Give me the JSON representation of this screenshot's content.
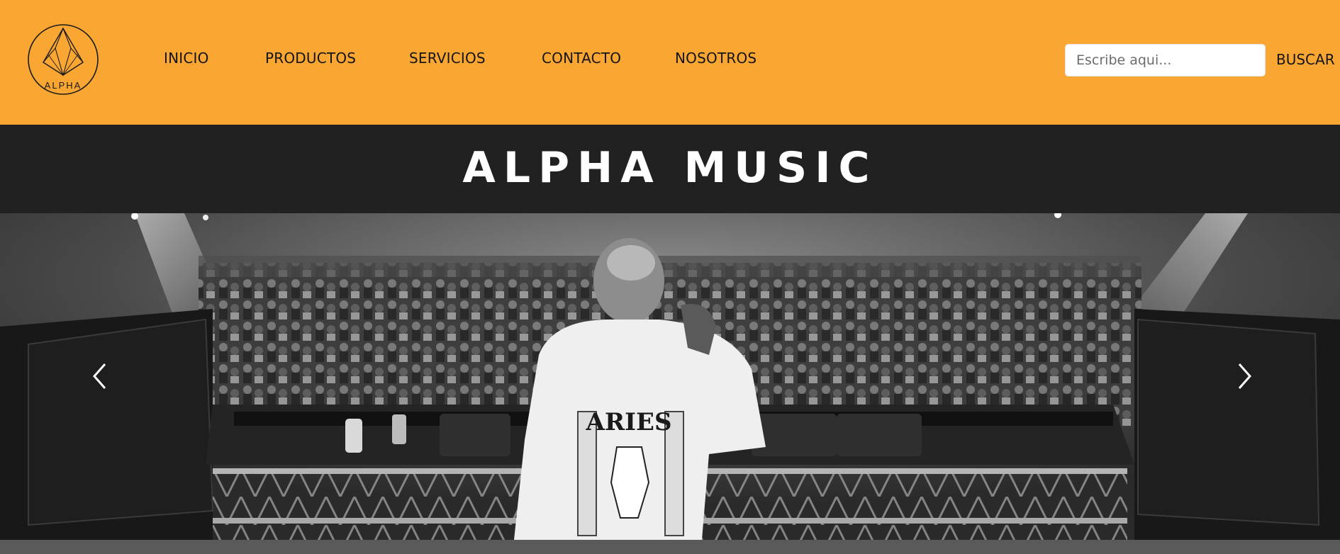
{
  "brand": {
    "logo_text": "ALPHA",
    "logo_alt": "alpha-diamond-logo"
  },
  "nav": {
    "items": [
      {
        "label": "INICIO"
      },
      {
        "label": "PRODUCTOS"
      },
      {
        "label": "SERVICIOS"
      },
      {
        "label": "CONTACTO"
      },
      {
        "label": "NOSOTROS"
      }
    ]
  },
  "search": {
    "placeholder": "Escribe aqui...",
    "value": "",
    "button_label": "BUSCAR"
  },
  "banner": {
    "title": "ALPHA MUSIC"
  },
  "carousel": {
    "image": "dj-crowd-black-white-photo",
    "shirt_text": "ARIES",
    "prev_icon": "chevron-left-icon",
    "next_icon": "chevron-right-icon"
  },
  "colors": {
    "header_bg": "#f9a633",
    "banner_bg": "#212121",
    "footer_strip": "#5a5a5a",
    "text_dark": "#141414",
    "text_light": "#ffffff"
  }
}
